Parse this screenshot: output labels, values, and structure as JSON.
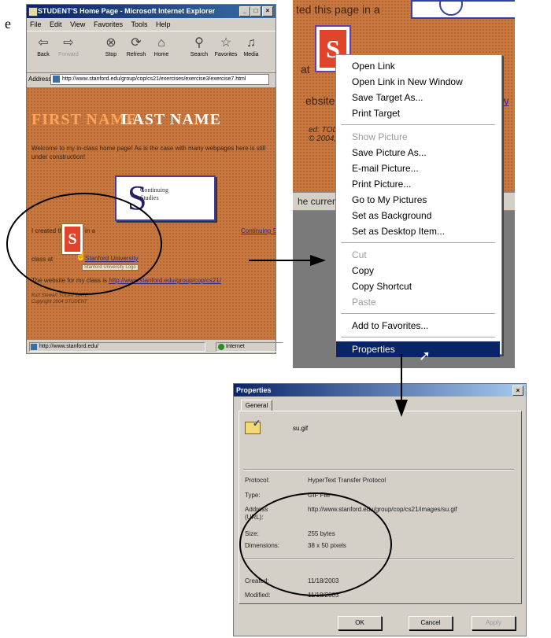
{
  "fragment": "e",
  "ie": {
    "title": "STUDENT'S Home Page - Microsoft Internet Explorer",
    "menu": [
      "File",
      "Edit",
      "View",
      "Favorites",
      "Tools",
      "Help"
    ],
    "toolbar": [
      "Back",
      "Forward",
      "Stop",
      "Refresh",
      "Home",
      "Search",
      "Favorites",
      "Media"
    ],
    "address_label": "Address",
    "address": "http://www.stanford.edu/group/cop/cs21/exercises/exercise3/exercise7.html",
    "page": {
      "first_name": "FIRST NAME",
      "last_name": "LAST NAME",
      "welcome": "Welcome to my in-class home page! As is the case with many webpages here is still under construction!",
      "logo_line1": "Continuing",
      "logo_line2": "Studies",
      "created": "I created this page in a",
      "created_link": "Continuing Studies",
      "class_at": "class at",
      "class_link": "Stanford University",
      "tooltip": "Stanford University Logo",
      "website": "The website for my class is",
      "website_link": "http://www.stanford.edu/group/cop/cs21/",
      "sig1": "Kurt Stewart TODAY DATE",
      "sig2": "Copyright 2004 STUDENT"
    },
    "status_left": "http://www.stanford.edu/",
    "status_right": "Internet"
  },
  "context": {
    "bg_top": "ted this page in a",
    "bg_frag1": "at",
    "bg_frag2": "ebsite",
    "bg_frag3": "ed: TODA",
    "bg_frag4": "© 2004, S",
    "bg_link": "w",
    "bg_status": "he curren",
    "groups": [
      [
        {
          "label": "Open Link"
        },
        {
          "label": "Open Link in New Window"
        },
        {
          "label": "Save Target As..."
        },
        {
          "label": "Print Target"
        }
      ],
      [
        {
          "label": "Show Picture",
          "disabled": true
        },
        {
          "label": "Save Picture As..."
        },
        {
          "label": "E-mail Picture..."
        },
        {
          "label": "Print Picture..."
        },
        {
          "label": "Go to My Pictures"
        },
        {
          "label": "Set as Background"
        },
        {
          "label": "Set as Desktop Item..."
        }
      ],
      [
        {
          "label": "Cut",
          "disabled": true
        },
        {
          "label": "Copy"
        },
        {
          "label": "Copy Shortcut"
        },
        {
          "label": "Paste",
          "disabled": true
        }
      ],
      [
        {
          "label": "Add to Favorites..."
        }
      ],
      [
        {
          "label": "Properties",
          "selected": true
        }
      ]
    ]
  },
  "dialog": {
    "title": "Properties",
    "close": "×",
    "tab": "General",
    "file_name": "su.gif",
    "rows": [
      {
        "label": "Protocol:",
        "value": "HyperText Transfer Protocol"
      },
      {
        "label": "Type:",
        "value": "GIF File"
      },
      {
        "label": "Address (URL):",
        "value": "http://www.stanford.edu/group/cop/cs21/images/su.gif"
      },
      {
        "label": "Size:",
        "value": "255 bytes"
      },
      {
        "label": "Dimensions:",
        "value": "38 x 50 pixels"
      },
      {
        "label": "Created:",
        "value": "11/18/2003"
      },
      {
        "label": "Modified:",
        "value": "11/18/2003"
      }
    ],
    "buttons": [
      {
        "label": "OK"
      },
      {
        "label": "Cancel"
      },
      {
        "label": "Apply",
        "disabled": true
      }
    ]
  },
  "colors": {
    "page_bg": "#c8783f",
    "accent": "#0a246a",
    "first_name": "#ffa55a"
  }
}
